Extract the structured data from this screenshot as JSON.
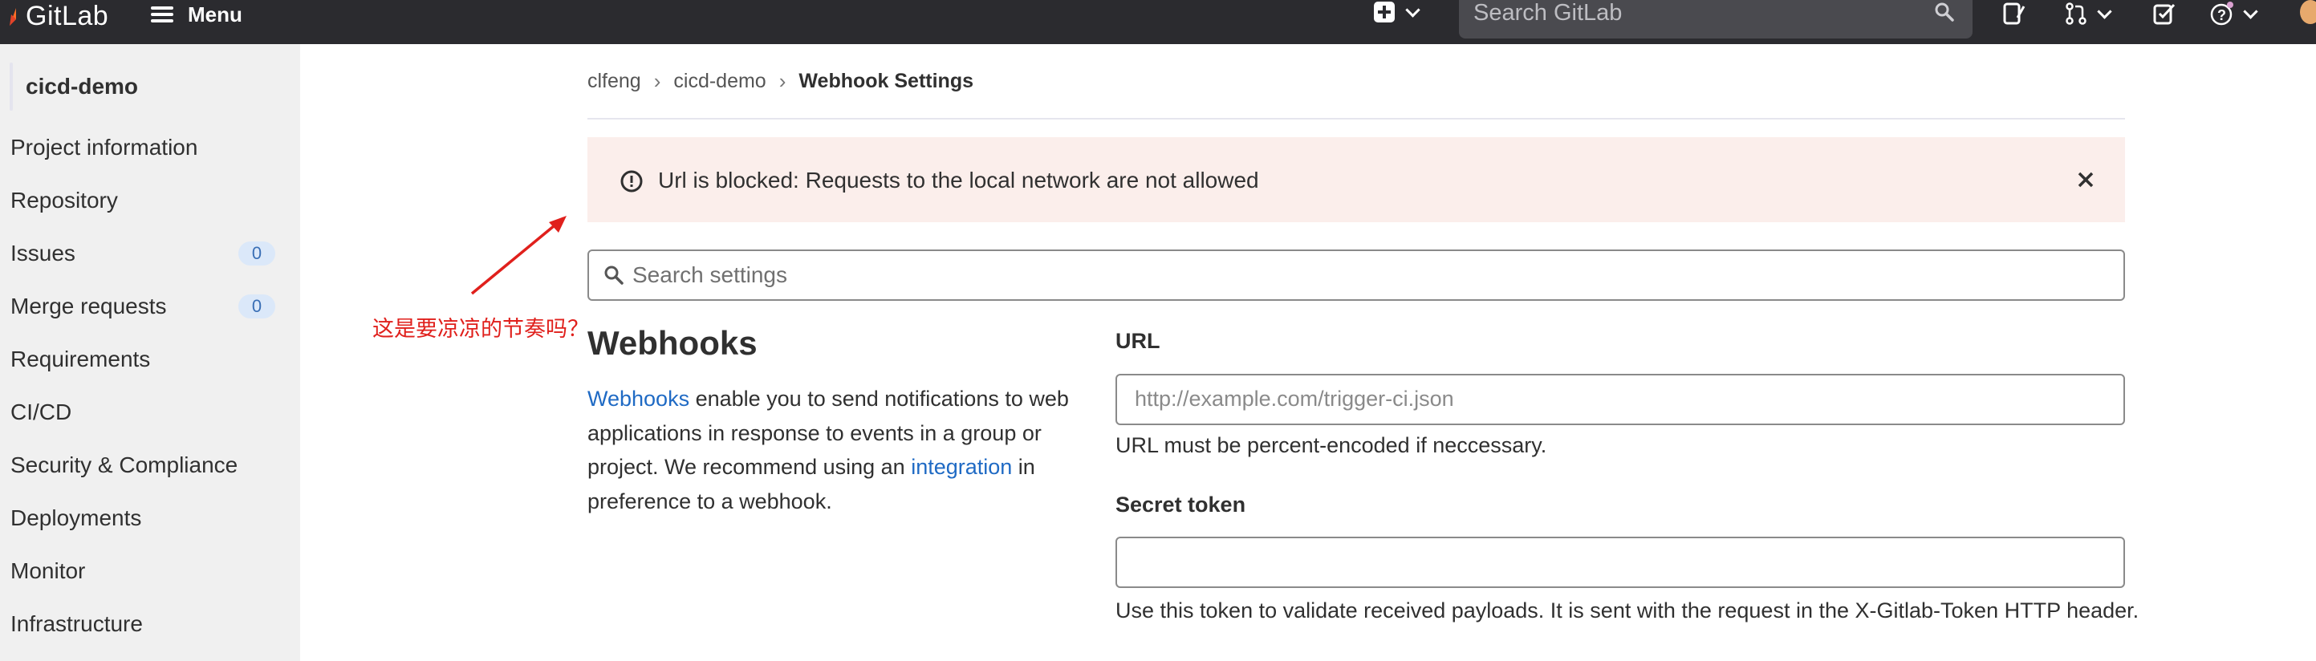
{
  "topbar": {
    "brand": "GitLab",
    "menu_label": "Menu",
    "search_placeholder": "Search GitLab"
  },
  "sidebar": {
    "project_name": "cicd-demo",
    "items": [
      {
        "label": "Project information"
      },
      {
        "label": "Repository"
      },
      {
        "label": "Issues",
        "badge": "0"
      },
      {
        "label": "Merge requests",
        "badge": "0"
      },
      {
        "label": "Requirements"
      },
      {
        "label": "CI/CD"
      },
      {
        "label": "Security & Compliance"
      },
      {
        "label": "Deployments"
      },
      {
        "label": "Monitor"
      },
      {
        "label": "Infrastructure"
      }
    ]
  },
  "breadcrumb": [
    "clfeng",
    "cicd-demo",
    "Webhook Settings"
  ],
  "alert": {
    "message": "Url is blocked: Requests to the local network are not allowed"
  },
  "settings_search": {
    "placeholder": "Search settings"
  },
  "webhooks": {
    "title": "Webhooks",
    "desc_link1": "Webhooks",
    "desc_part1": " enable you to send notifications to web applications in response to events in a group or project. We recommend using an ",
    "desc_link2": "integration",
    "desc_part2": " in preference to a webhook."
  },
  "form": {
    "url_label": "URL",
    "url_placeholder": "http://example.com/trigger-ci.json",
    "url_help": "URL must be percent-encoded if neccessary.",
    "secret_label": "Secret token",
    "secret_value": "",
    "secret_help": "Use this token to validate received payloads. It is sent with the request in the X-Gitlab-Token HTTP header."
  },
  "annotation": {
    "text": "这是要凉凉的节奏吗？",
    "color": "#e0201c"
  },
  "colors": {
    "topbar": "#2b2b2f",
    "sidebar": "#f0f0f0",
    "alert_bg": "#fbeeeb",
    "link": "#1f6ac4"
  }
}
